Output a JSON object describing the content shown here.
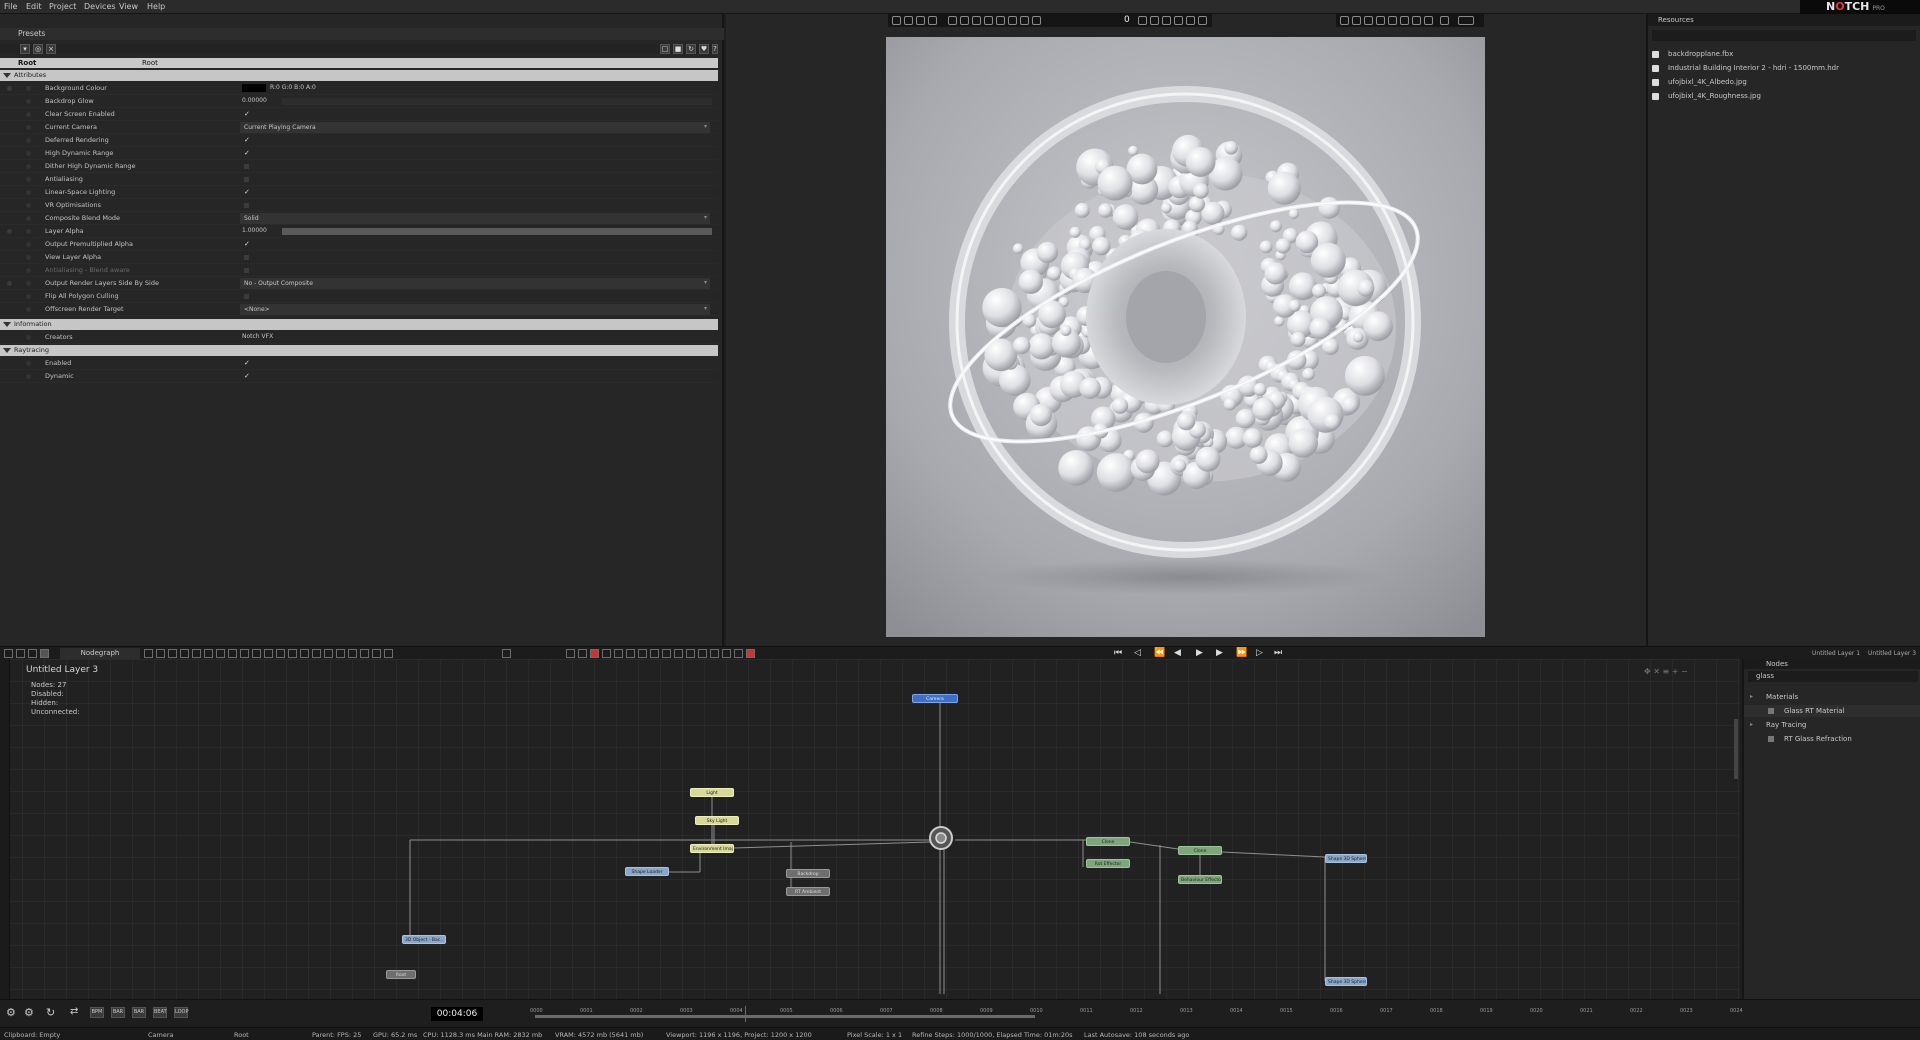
{
  "menu": {
    "items": [
      "File",
      "Edit",
      "Project",
      "Devices",
      "View",
      "Help"
    ]
  },
  "logo": {
    "name": "NOTCH",
    "edition": "PRO"
  },
  "presets_panel": {
    "title": "Presets",
    "root_label": "Root",
    "root_value": "Root"
  },
  "attributes": {
    "section": "Attributes",
    "rows": [
      {
        "label": "Background Colour",
        "value": "R:0 G:0 B:0 A:0"
      },
      {
        "label": "Backdrop Glow",
        "value": "0.00000"
      },
      {
        "label": "Clear Screen Enabled",
        "value": "✓"
      },
      {
        "label": "Current Camera",
        "value": "Current Playing Camera"
      },
      {
        "label": "Deferred Rendering",
        "value": "✓"
      },
      {
        "label": "High Dynamic Range",
        "value": "✓"
      },
      {
        "label": "Dither High Dynamic Range",
        "value": ""
      },
      {
        "label": "Antialiasing",
        "value": ""
      },
      {
        "label": "Linear-Space Lighting",
        "value": "✓"
      },
      {
        "label": "VR Optimisations",
        "value": ""
      },
      {
        "label": "Composite Blend Mode",
        "value": "Solid"
      },
      {
        "label": "Layer Alpha",
        "value": "1.00000"
      },
      {
        "label": "Output Premultiplied Alpha",
        "value": "✓"
      },
      {
        "label": "View Layer Alpha",
        "value": ""
      },
      {
        "label": "Antialiasing - Blend aware",
        "value": ""
      },
      {
        "label": "Output Render Layers Side By Side",
        "value": "No - Output Composite"
      },
      {
        "label": "Flip All Polygon Culling",
        "value": ""
      },
      {
        "label": "Offscreen Render Target",
        "value": "<None>"
      }
    ]
  },
  "information": {
    "section": "Information",
    "rows": [
      {
        "label": "Creators",
        "value": "Notch VFX"
      }
    ]
  },
  "raytracing": {
    "section": "Raytracing",
    "rows": [
      {
        "label": "Enabled",
        "value": "✓"
      },
      {
        "label": "Dynamic",
        "value": "✓"
      }
    ]
  },
  "viewport_toolbar": {
    "counter": "0"
  },
  "resources": {
    "title": "Resources",
    "files": [
      "backdropplane.fbx",
      "Industrial Building Interior 2 - hdri - 1500mm.hdr",
      "ufojbixl_4K_Albedo.jpg",
      "ufojbixl_4K_Roughness.jpg"
    ]
  },
  "nodegraph": {
    "tab": "Nodegraph",
    "layer_title": "Untitled Layer 3",
    "stats": [
      "Nodes: 27",
      "Disabled:",
      "Hidden:",
      "Unconnected:"
    ],
    "right_tabs": [
      "Untitled Layer 1",
      "Untitled Layer 3"
    ]
  },
  "nodes_panel": {
    "title": "Nodes",
    "search": "glass",
    "groups": [
      {
        "name": "Materials",
        "items": [
          "Glass RT Material"
        ]
      },
      {
        "name": "Ray Tracing",
        "items": [
          "RT Glass Refraction"
        ]
      }
    ]
  },
  "graph_nodes": [
    {
      "label": "Camera",
      "color": "n-bb"
    },
    {
      "label": "Light",
      "color": "n-y"
    },
    {
      "label": "Sky Light",
      "color": "n-y"
    },
    {
      "label": "Environment Image",
      "color": "n-y"
    },
    {
      "label": "Shape Loader",
      "color": "n-b"
    },
    {
      "label": "Backdrop",
      "color": "n-gr"
    },
    {
      "label": "RT Ambient",
      "color": "n-gr"
    },
    {
      "label": "Clone",
      "color": "n-g"
    },
    {
      "label": "Rot Effector",
      "color": "n-g"
    },
    {
      "label": "Clone",
      "color": "n-g"
    },
    {
      "label": "Behaviour Effector",
      "color": "n-g"
    },
    {
      "label": "Shape 3D Sphere",
      "color": "n-b"
    },
    {
      "label": "Shape 3D Sphere",
      "color": "n-b"
    },
    {
      "label": "3D Object - Bac..",
      "color": "n-b"
    },
    {
      "label": "Root",
      "color": "n-gr"
    }
  ],
  "timeline": {
    "current_time": "00:04:06",
    "buttons": [
      "BPM",
      "BAR",
      "BAR",
      "BEAT",
      "LOOP"
    ],
    "ticks": [
      "0000",
      "0001",
      "0002",
      "0003",
      "0004",
      "0005",
      "0006",
      "0007",
      "0008",
      "0009",
      "0010",
      "0011",
      "0012",
      "0013",
      "0014",
      "0015",
      "0016",
      "0017",
      "0018",
      "0019",
      "0020",
      "0021",
      "0022",
      "0023",
      "0024"
    ]
  },
  "status_bar": {
    "clipboard": "Clipboard: Empty",
    "camera": "Camera",
    "root": "Root",
    "parent_fps": "Parent: FPS: 25",
    "gpu": "GPU: 65.2 ms",
    "cpu": "CPU: 1128.3 ms  Main RAM: 2832 mb",
    "vram": "VRAM: 4572 mb (5641 mb)",
    "viewport": "Viewport: 1196 x 1196, Project: 1200 x 1200",
    "pixel_scale": "Pixel Scale: 1 x 1",
    "refine": "Refine Steps: 1000/1000, Elapsed Time: 01m:20s",
    "autosave": "Last Autosave: 108 seconds ago"
  },
  "colors": {
    "accent": "#e23a2a",
    "panel": "#262626",
    "section": "#c6c6c6"
  }
}
